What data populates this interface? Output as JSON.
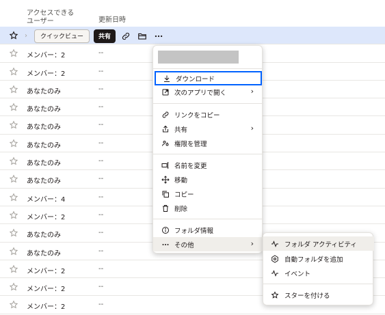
{
  "header": {
    "access_label": "アクセスできる\nユーザー",
    "updated_label": "更新日時"
  },
  "toolbar": {
    "quick_view": "クイックビュー",
    "share": "共有"
  },
  "rows": [
    {
      "access": "",
      "updated": "",
      "selected": true
    },
    {
      "access": "メンバー：2",
      "updated": "--"
    },
    {
      "access": "メンバー：2",
      "updated": "--"
    },
    {
      "access": "あなたのみ",
      "updated": "--"
    },
    {
      "access": "あなたのみ",
      "updated": "--"
    },
    {
      "access": "あなたのみ",
      "updated": "--"
    },
    {
      "access": "あなたのみ",
      "updated": "--"
    },
    {
      "access": "あなたのみ",
      "updated": "--"
    },
    {
      "access": "あなたのみ",
      "updated": "--"
    },
    {
      "access": "メンバー：4",
      "updated": "--"
    },
    {
      "access": "メンバー：2",
      "updated": "--"
    },
    {
      "access": "あなたのみ",
      "updated": "--"
    },
    {
      "access": "あなたのみ",
      "updated": "--"
    },
    {
      "access": "メンバー：2",
      "updated": "--"
    },
    {
      "access": "メンバー：2",
      "updated": "--"
    },
    {
      "access": "メンバー：2",
      "updated": "--"
    }
  ],
  "menu": {
    "download": "ダウンロード",
    "open_in_app": "次のアプリで開く",
    "copy_link": "リンクをコピー",
    "share": "共有",
    "manage_permissions": "権限を管理",
    "rename": "名前を変更",
    "move": "移動",
    "copy": "コピー",
    "delete": "削除",
    "folder_info": "フォルダ情報",
    "more": "その他"
  },
  "submenu": {
    "folder_activity": "フォルダ アクティビティ",
    "add_auto_folder": "自動フォルダを追加",
    "events": "イベント",
    "add_star": "スターを付ける"
  },
  "colors": {
    "selected_row": "#dde7fb",
    "focus_outline": "#0061fe",
    "share_button": "#1e1919"
  }
}
